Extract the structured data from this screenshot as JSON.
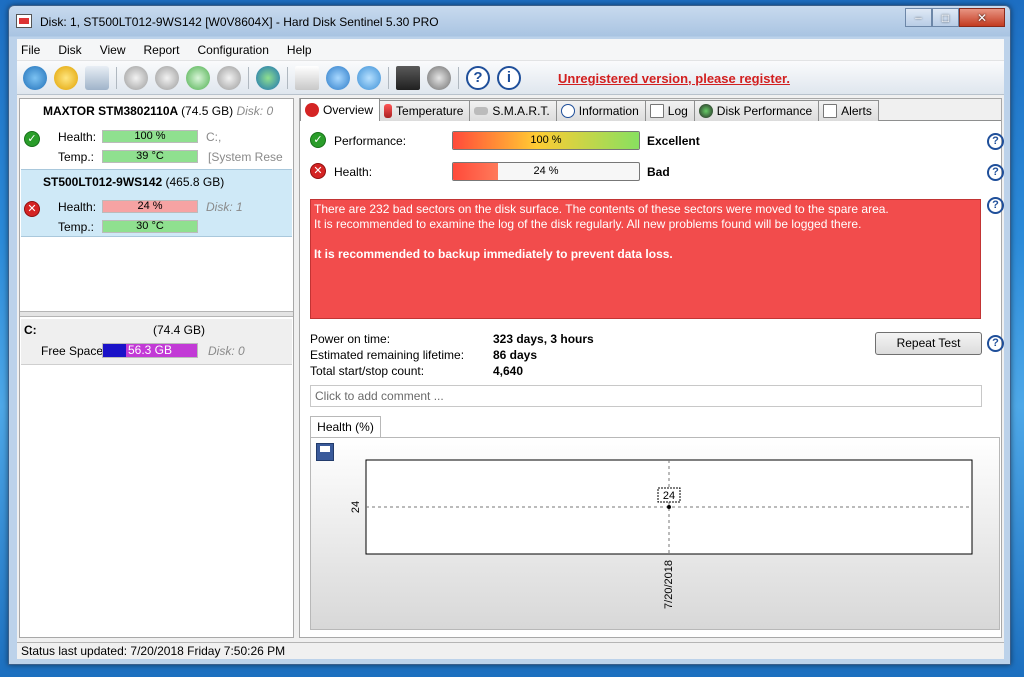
{
  "window": {
    "title": "Disk: 1, ST500LT012-9WS142 [W0V8604X]  -  Hard Disk Sentinel 5.30 PRO",
    "minimize": "0",
    "maximize": "1",
    "close": "r"
  },
  "menu": [
    "File",
    "Disk",
    "View",
    "Report",
    "Configuration",
    "Help"
  ],
  "toolbar": {
    "icons": [
      "refresh-icon",
      "alert-icon",
      "disk-icon",
      "disk-test-icon",
      "disk-test-icon-2",
      "disk-ok-icon",
      "disk-search-icon",
      "globe-icon",
      "report-icon",
      "backup-icon",
      "network-icon",
      "config-icon",
      "sound-icon",
      "help-icon",
      "info-icon"
    ],
    "unregistered": "Unregistered version, please register."
  },
  "disks": [
    {
      "name": "MAXTOR STM3802110A",
      "capacity": "(74.5 GB)",
      "disk_no": "Disk: 0",
      "health_label": "Health:",
      "health": "100 %",
      "health_pct": 100,
      "health_extra": "C:,",
      "temp_label": "Temp.:",
      "temp": "39 °C",
      "temp_extra": "[System Rese",
      "status": "ok"
    },
    {
      "name": "ST500LT012-9WS142",
      "capacity": "(465.8 GB)",
      "disk_no": "Disk: 1",
      "health_label": "Health:",
      "health": "24 %",
      "health_pct": 24,
      "temp_label": "Temp.:",
      "temp": "30 °C",
      "status": "bad"
    }
  ],
  "volume": {
    "letter": "C:",
    "size": "(74.4 GB)",
    "free_label": "Free Space",
    "free": "56.3 GB",
    "disk_no": "Disk: 0"
  },
  "tabs": [
    "Overview",
    "Temperature",
    "S.M.A.R.T.",
    "Information",
    "Log",
    "Disk Performance",
    "Alerts"
  ],
  "overview": {
    "performance_label": "Performance:",
    "performance_value": "100 %",
    "performance_pct": 100,
    "performance_rating": "Excellent",
    "health_label": "Health:",
    "health_value": "24 %",
    "health_pct": 24,
    "health_rating": "Bad",
    "alert_lines": [
      "There are 232 bad sectors on the disk surface. The contents of these sectors were moved to the spare area.",
      "It is recommended to examine the log of the disk regularly. All new problems found will be logged there."
    ],
    "alert_strong": "It is recommended to backup immediately to prevent data loss.",
    "power_on_label": "Power on time:",
    "power_on": "323 days, 3 hours",
    "lifetime_label": "Estimated remaining lifetime:",
    "lifetime": "86 days",
    "startstop_label": "Total start/stop count:",
    "startstop": "4,640",
    "repeat_test": "Repeat Test",
    "comment_placeholder": "Click to add comment ..."
  },
  "chart_tab": "Health (%)",
  "chart_data": {
    "type": "line",
    "x": [
      "7/20/2018"
    ],
    "series": [
      {
        "values": [
          24
        ]
      }
    ],
    "y_tick": "24",
    "point_label": "24"
  },
  "status": "Status last updated: 7/20/2018 Friday 7:50:26 PM",
  "colors": {
    "alert_bg": "#f24c4c",
    "link_red": "#d21f1f",
    "ok": "#2a9d2a",
    "bad": "#d42424"
  }
}
